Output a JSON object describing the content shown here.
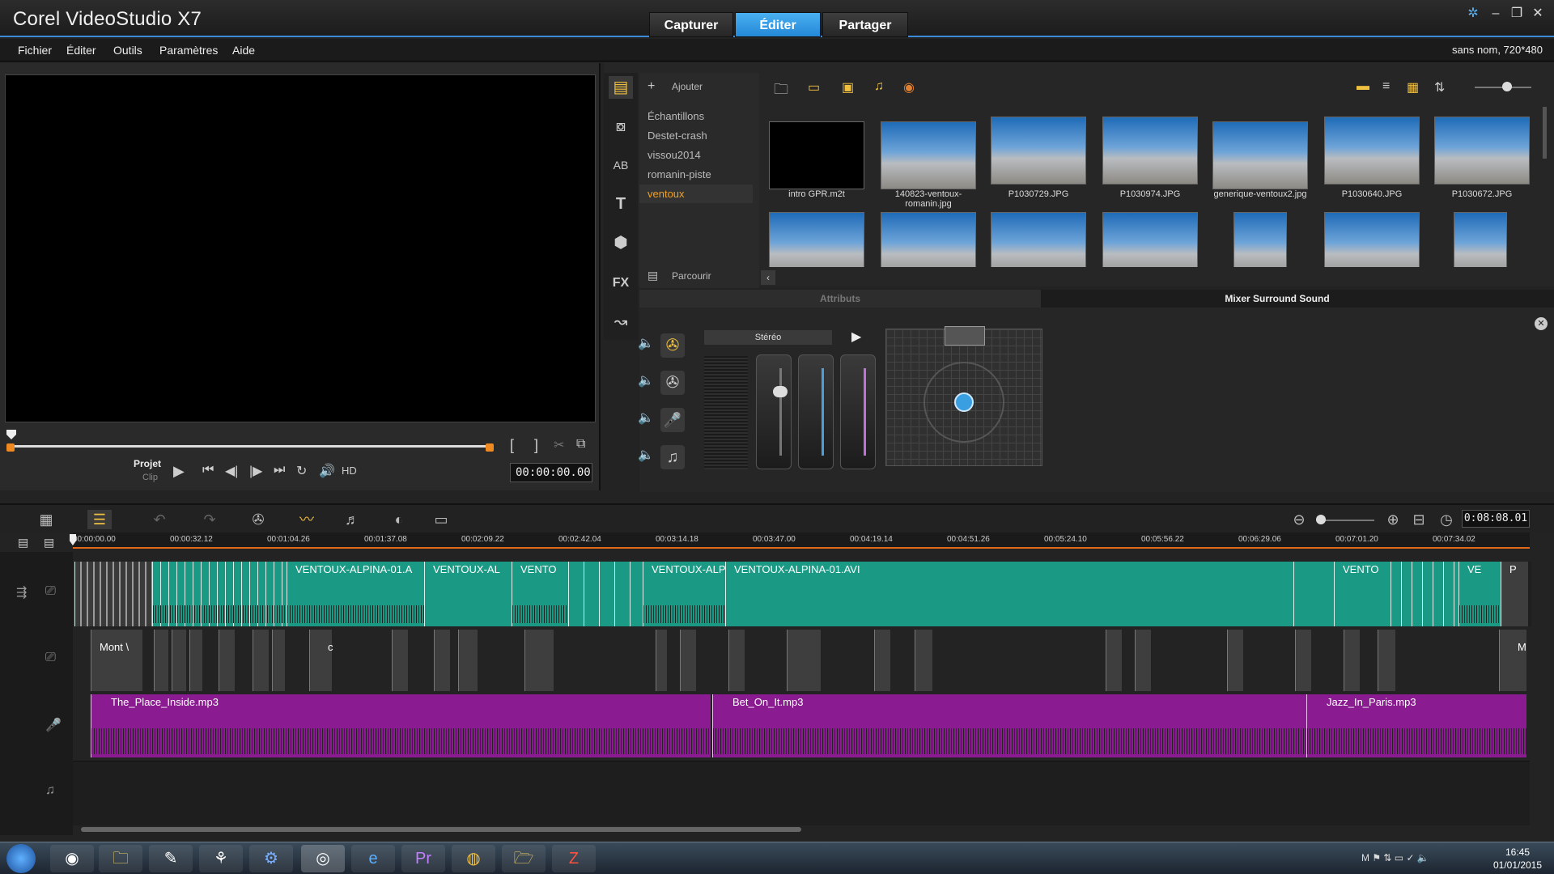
{
  "titlebar": {
    "app_title": "Corel VideoStudio X7",
    "mode_tabs": [
      "Capturer",
      "Éditer",
      "Partager"
    ],
    "active_tab": "Éditer"
  },
  "menu": {
    "items": [
      "Fichier",
      "Éditer",
      "Outils",
      "Paramètres",
      "Aide"
    ],
    "project_info": "sans nom, 720*480"
  },
  "player": {
    "mode_project": "Projet",
    "mode_clip": "Clip",
    "quality": "HD",
    "timecode": "00:00:00.00"
  },
  "library": {
    "add_label": "Ajouter",
    "browse_label": "Parcourir",
    "folders": [
      "Échantillons",
      "Destet-crash",
      "vissou2014",
      "romanin-piste",
      "ventoux"
    ],
    "selected_folder": "ventoux",
    "thumbnails": [
      {
        "name": "intro GPR.m2t"
      },
      {
        "name": "140823-ventoux-romanin.jpg"
      },
      {
        "name": "P1030729.JPG"
      },
      {
        "name": "P1030974.JPG"
      },
      {
        "name": "generique-ventoux2.jpg"
      },
      {
        "name": "P1030640.JPG"
      },
      {
        "name": "P1030672.JPG"
      }
    ]
  },
  "attributes": {
    "tab_attributes": "Attributs",
    "tab_mixer": "Mixer Surround Sound",
    "stereo_label": "Stéréo"
  },
  "timeline": {
    "timecode": "0:08:08.01",
    "ruler_ticks": [
      "00:00:00.00",
      "00:00:32.12",
      "00:01:04.26",
      "00:01:37.08",
      "00:02:09.22",
      "00:02:42.04",
      "00:03:14.18",
      "00:03:47.00",
      "00:04:19.14",
      "00:04:51.26",
      "00:05:24.10",
      "00:05:56.22",
      "00:06:29.06",
      "00:07:01.20",
      "00:07:34.02"
    ],
    "video_clips": [
      "VENTOUX-ALPINA-01.A",
      "VENTOUX-AL",
      "VENTO",
      "VENTOUX-ALP",
      "VENTOUX-ALPINA-01.AVI",
      "VENTO",
      "VE",
      "P"
    ],
    "overlay_clips": [
      "Mont \\",
      "c",
      "M"
    ],
    "music_clips": [
      "The_Place_Inside.mp3",
      "Bet_On_It.mp3",
      "Jazz_In_Paris.mp3"
    ]
  },
  "taskbar": {
    "time": "16:45",
    "date": "01/01/2015"
  },
  "colors": {
    "accent": "#2e8fe0",
    "video_track": "#1a9a84",
    "music_track": "#8b1b90",
    "ruler_line": "#e06a1a"
  }
}
